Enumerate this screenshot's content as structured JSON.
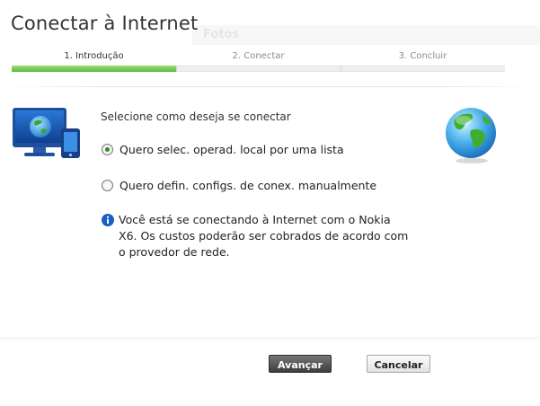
{
  "window": {
    "title": "Conectar à Internet",
    "background_label": "Fotos"
  },
  "steps": [
    {
      "label": "1. Introdução",
      "active": true
    },
    {
      "label": "2. Conectar",
      "active": false
    },
    {
      "label": "3. Concluir",
      "active": false
    }
  ],
  "progress": {
    "completed_fraction": 0.333
  },
  "main": {
    "prompt": "Selecione como deseja se conectar",
    "options": [
      {
        "label": "Quero selec. operad. local por uma lista",
        "selected": true
      },
      {
        "label": "Quero defin. configs. de conex. manualmente",
        "selected": false
      }
    ],
    "info_text": "Você está se conectando à Internet com o Nokia\nX6. Os custos poderão ser cobrados de acordo com\no provedor de rede."
  },
  "buttons": {
    "next": "Avançar",
    "cancel": "Cancelar"
  },
  "icons": {
    "illustration": "computer-phone-globe-icon",
    "globe": "globe-icon",
    "info": "info-icon"
  },
  "colors": {
    "progress_green": "#5cb83c",
    "info_blue": "#1a5fc4",
    "primary_button": "#3d3d3d"
  }
}
